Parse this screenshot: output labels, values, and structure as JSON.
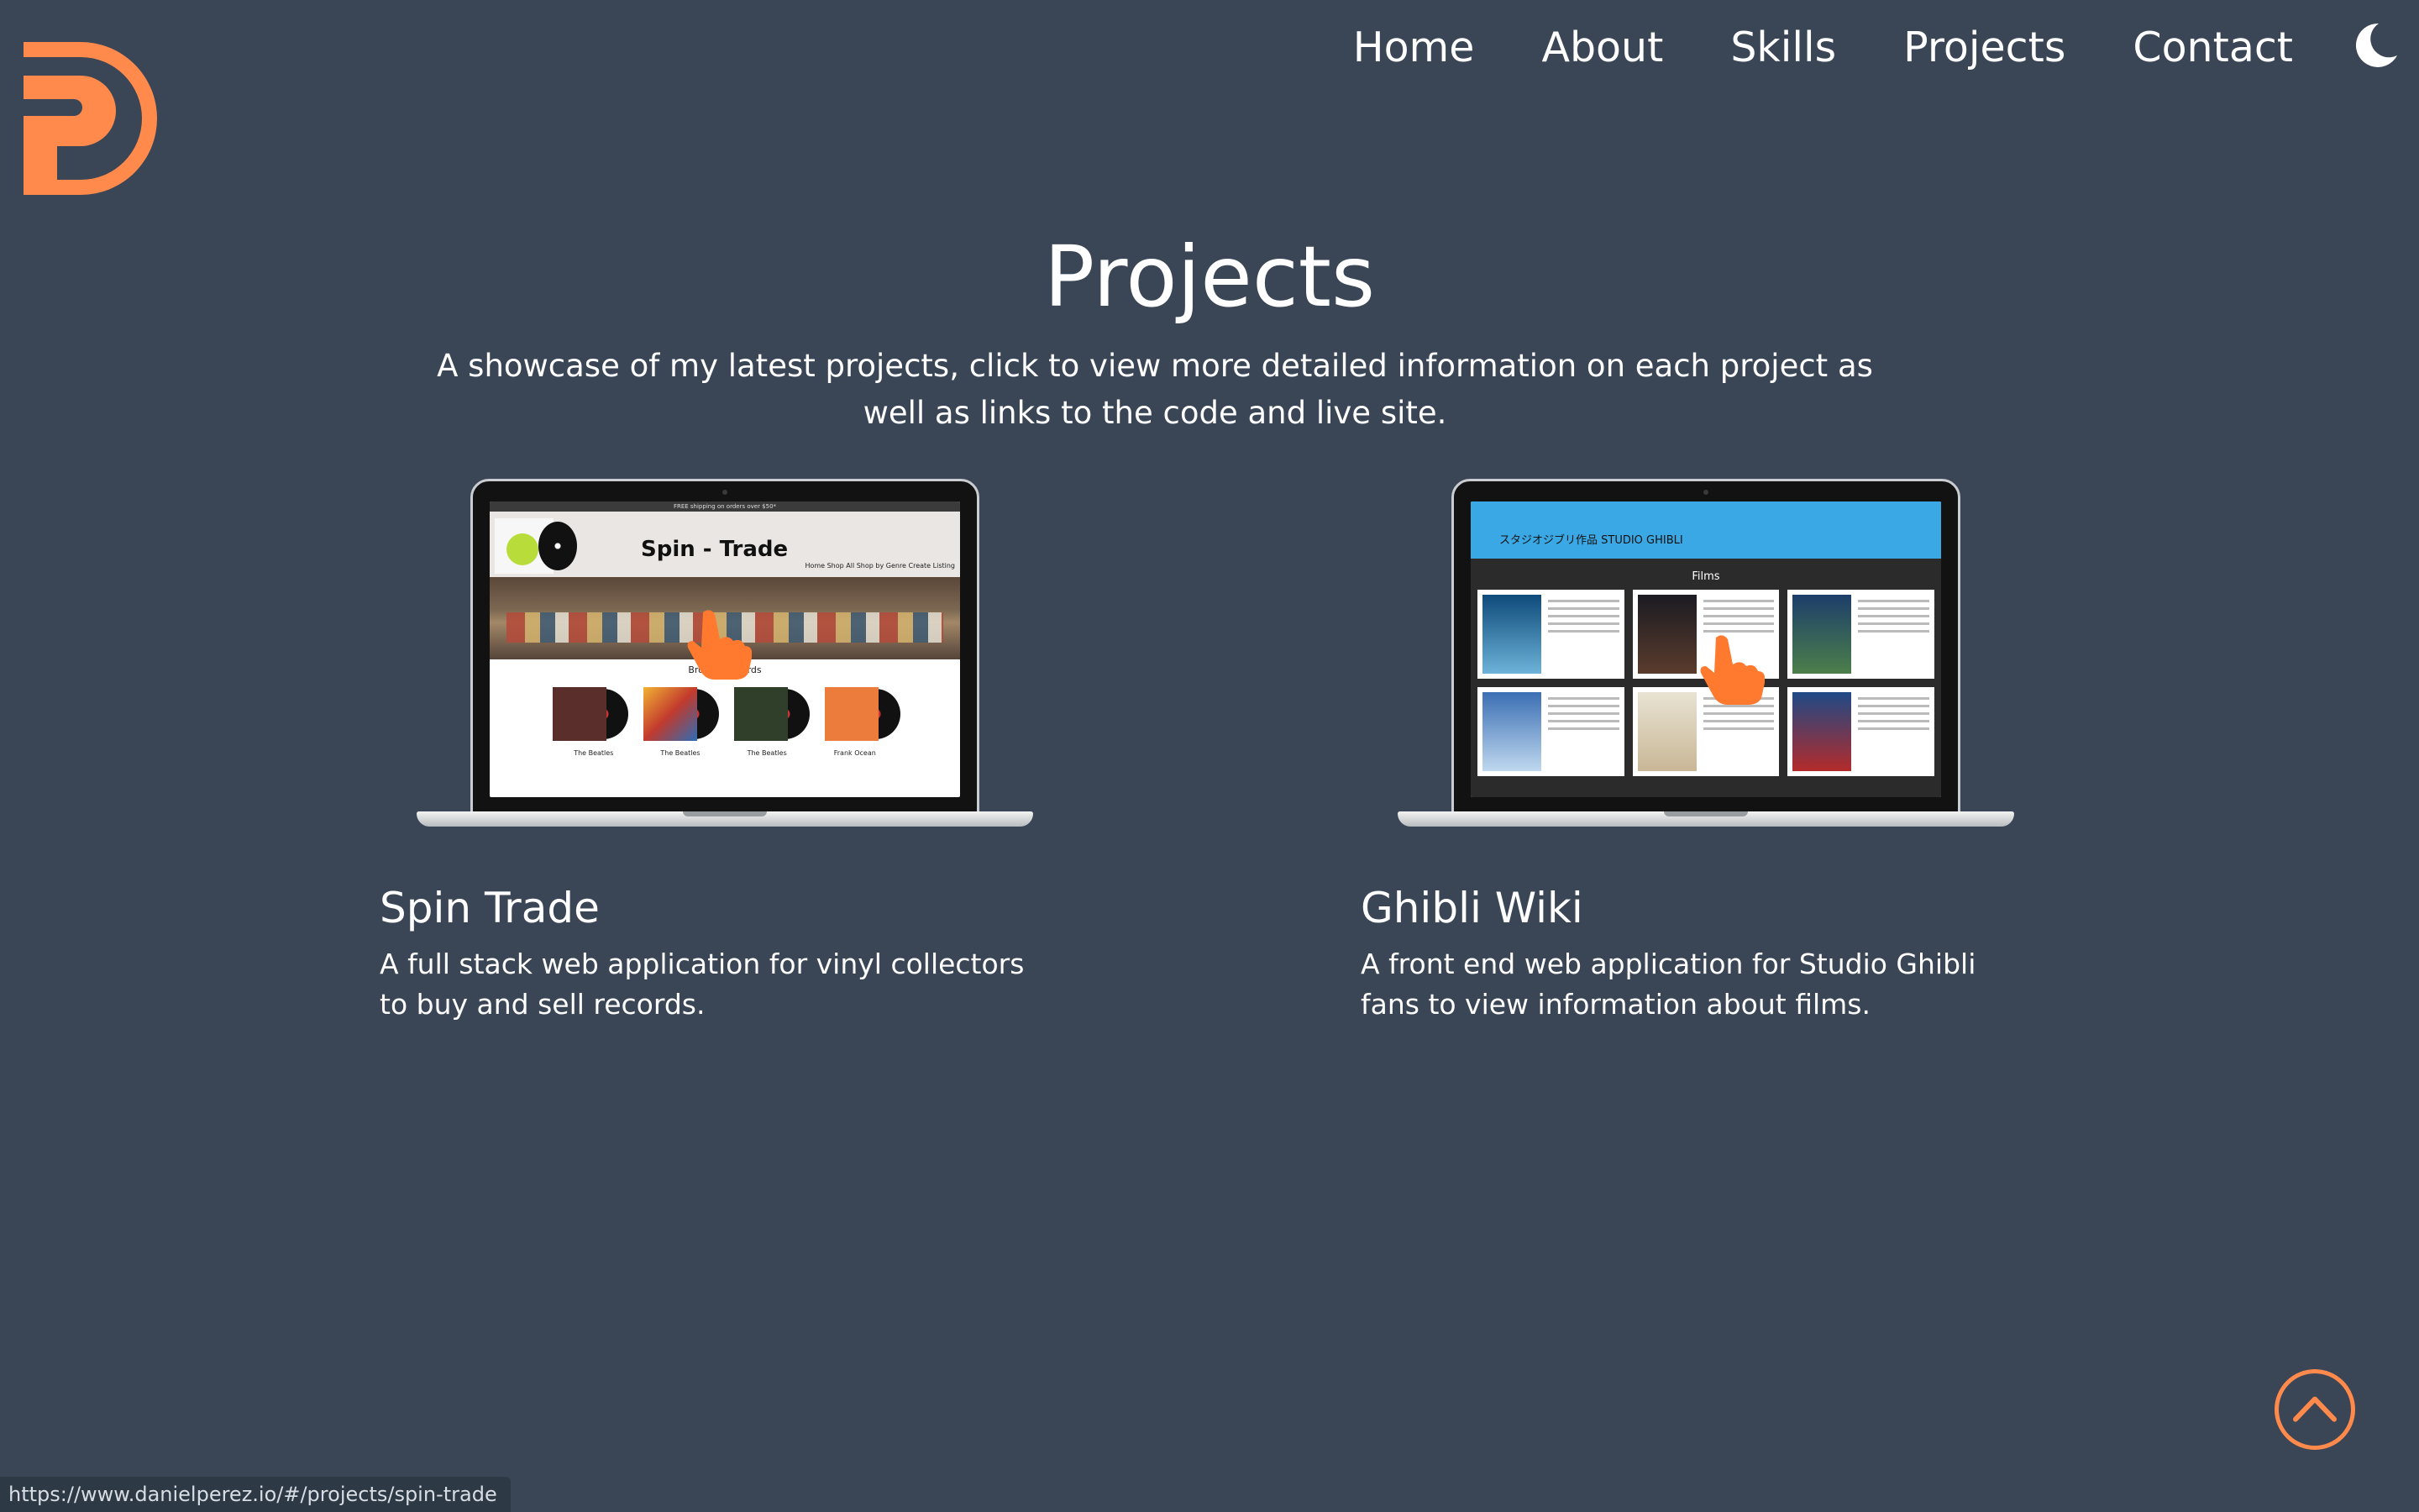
{
  "header": {
    "logo_icon": "dp-monogram-logo",
    "nav": [
      "Home",
      "About",
      "Skills",
      "Projects",
      "Contact"
    ],
    "theme_toggle_icon": "moon-icon"
  },
  "main": {
    "title": "Projects",
    "subtitle": "A showcase of my latest projects, click to view more detailed information on each project as well as links to the code and live site."
  },
  "projects": [
    {
      "title": "Spin Trade",
      "description": "A full stack web application for vinyl collectors to buy and sell records.",
      "screenshot": {
        "banner": "FREE shipping on orders over $50*",
        "site_title": "Spin - Trade",
        "menu": "Home   Shop All   Shop by Genre   Create Listing",
        "section": "Browse Records",
        "captions": [
          "The Beatles",
          "The Beatles",
          "The Beatles",
          "Frank Ocean"
        ]
      }
    },
    {
      "title": "Ghibli Wiki",
      "description": "A front end web application for Studio Ghibli fans to view information about films.",
      "screenshot": {
        "logo": "スタジオジブリ作品 STUDIO GHIBLI",
        "section": "Films"
      }
    }
  ],
  "back_to_top_icon": "chevron-up-circle-icon",
  "status_bar": {
    "url": "https://www.danielperez.io/#/projects/spin-trade"
  },
  "colors": {
    "background": "#3a4655",
    "accent": "#ff8a4b",
    "text": "#ffffff"
  }
}
